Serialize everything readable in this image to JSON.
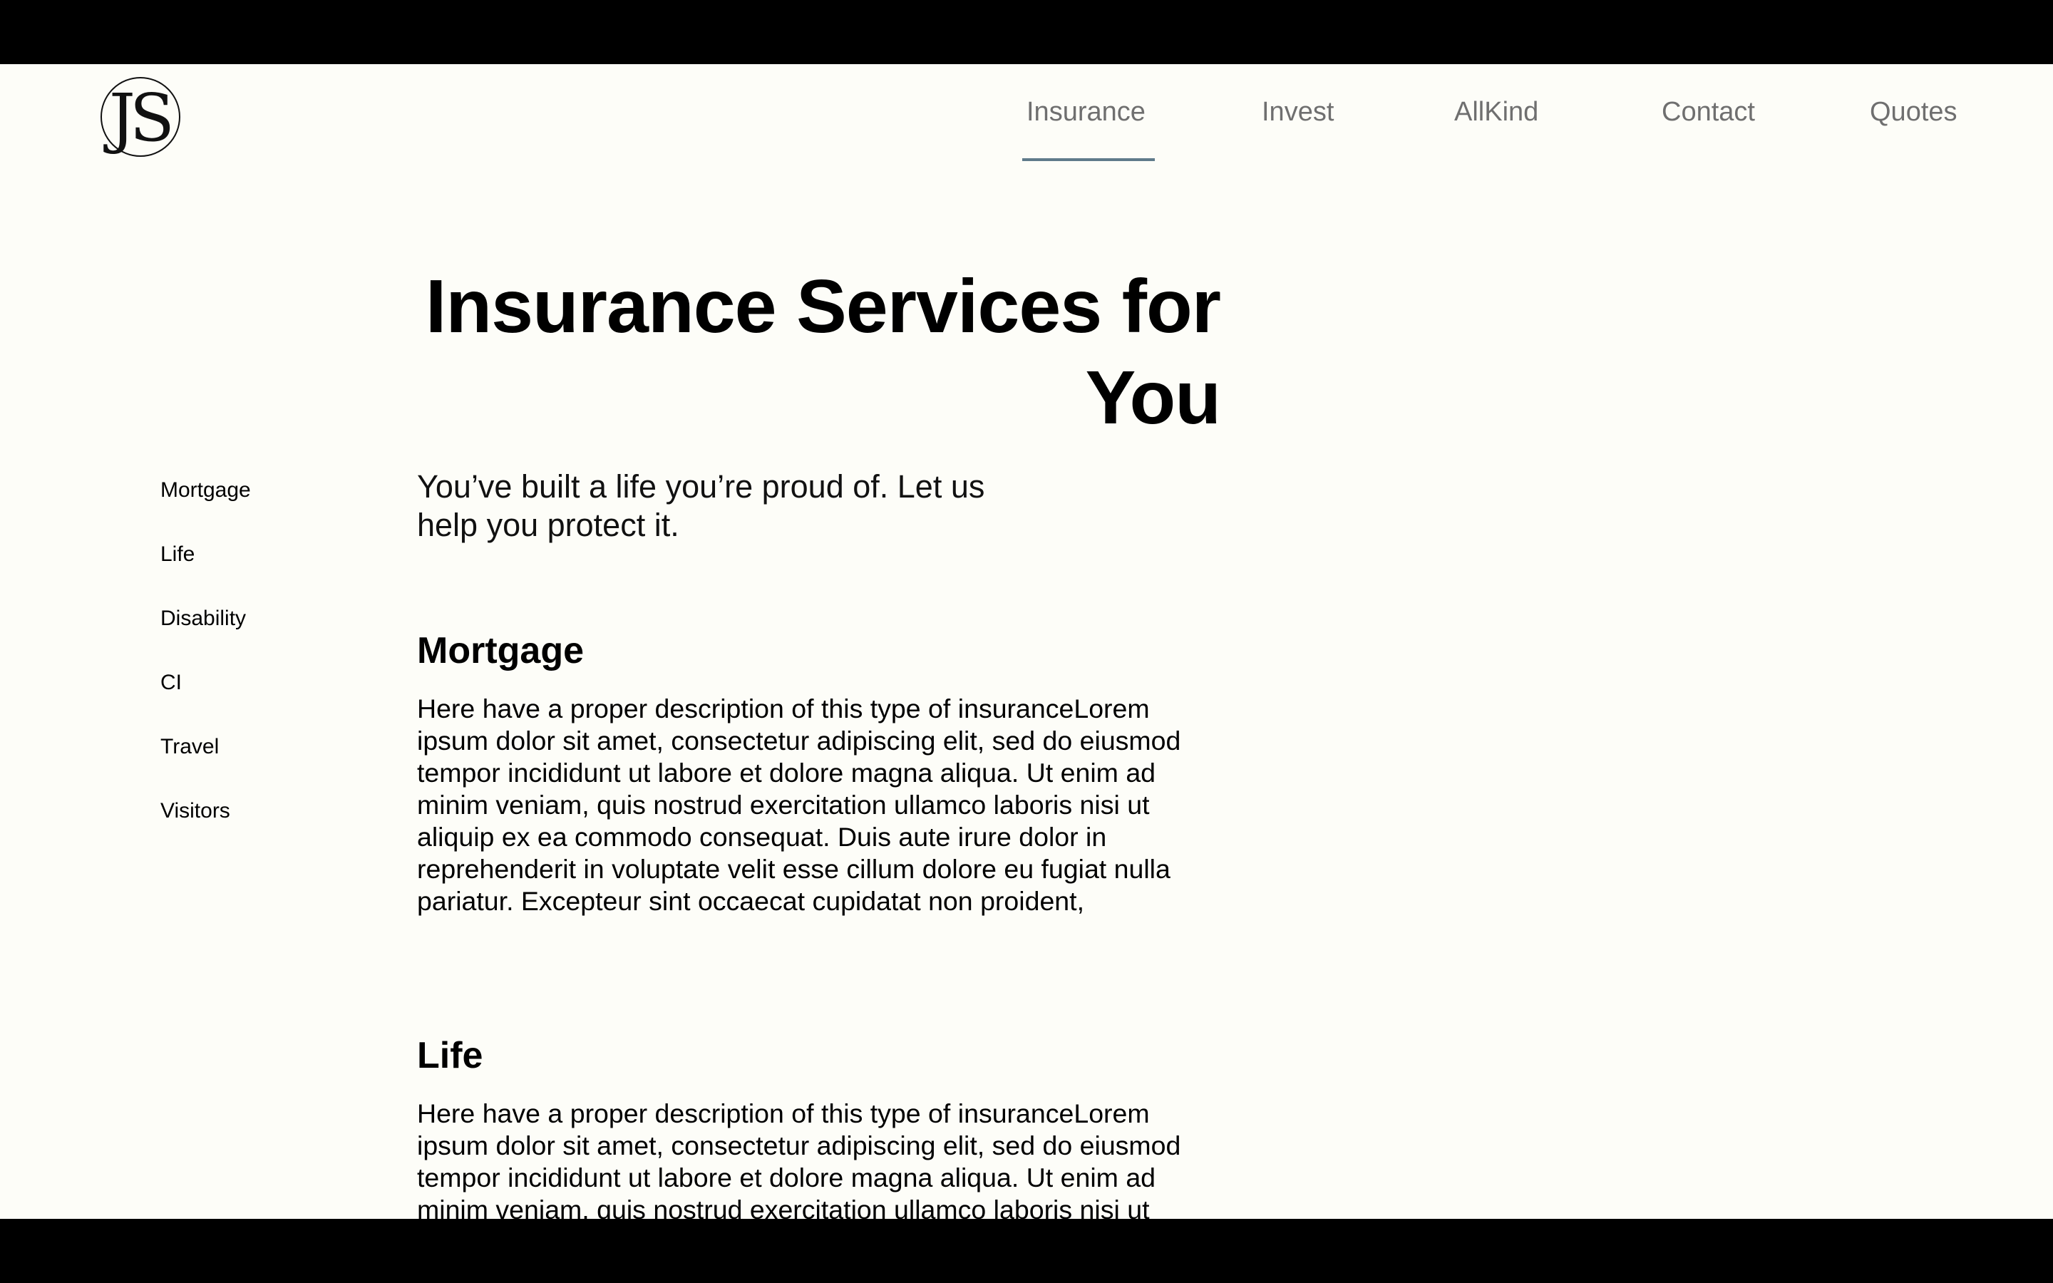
{
  "logo": {
    "text": "JS"
  },
  "nav": {
    "items": [
      {
        "label": "Insurance",
        "active": true
      },
      {
        "label": "Invest",
        "active": false
      },
      {
        "label": "AllKind",
        "active": false
      },
      {
        "label": "Contact",
        "active": false
      },
      {
        "label": "Quotes",
        "active": false
      }
    ]
  },
  "hero": {
    "title_line1": "Insurance Services for",
    "title_line2": "You",
    "tagline": "You’ve built a life you’re proud of. Let us help you protect it."
  },
  "side_nav": {
    "items": [
      {
        "label": "Mortgage"
      },
      {
        "label": "Life"
      },
      {
        "label": "Disability"
      },
      {
        "label": "CI"
      },
      {
        "label": "Travel"
      },
      {
        "label": "Visitors"
      }
    ]
  },
  "sections": [
    {
      "heading": "Mortgage",
      "body": "Here have a proper description of this type of insuranceLorem ipsum dolor sit amet, consectetur adipiscing elit, sed do eiusmod tempor incididunt ut labore et dolore magna aliqua. Ut enim ad minim veniam, quis nostrud exercitation ullamco laboris nisi ut aliquip ex ea commodo consequat. Duis aute irure dolor in reprehenderit in voluptate velit esse cillum dolore eu fugiat nulla pariatur. Excepteur sint occaecat cupidatat non proident,"
    },
    {
      "heading": "Life",
      "body": "Here have a proper description of this type of insuranceLorem ipsum dolor sit amet, consectetur adipiscing elit, sed do eiusmod tempor incididunt ut labore et dolore magna aliqua. Ut enim ad minim veniam, quis nostrud exercitation ullamco laboris nisi ut"
    }
  ],
  "colors": {
    "page_background": "#fdfdf8",
    "nav_text": "#6f6f6f",
    "nav_active_underline": "#5f7a8a",
    "text": "#000000"
  }
}
